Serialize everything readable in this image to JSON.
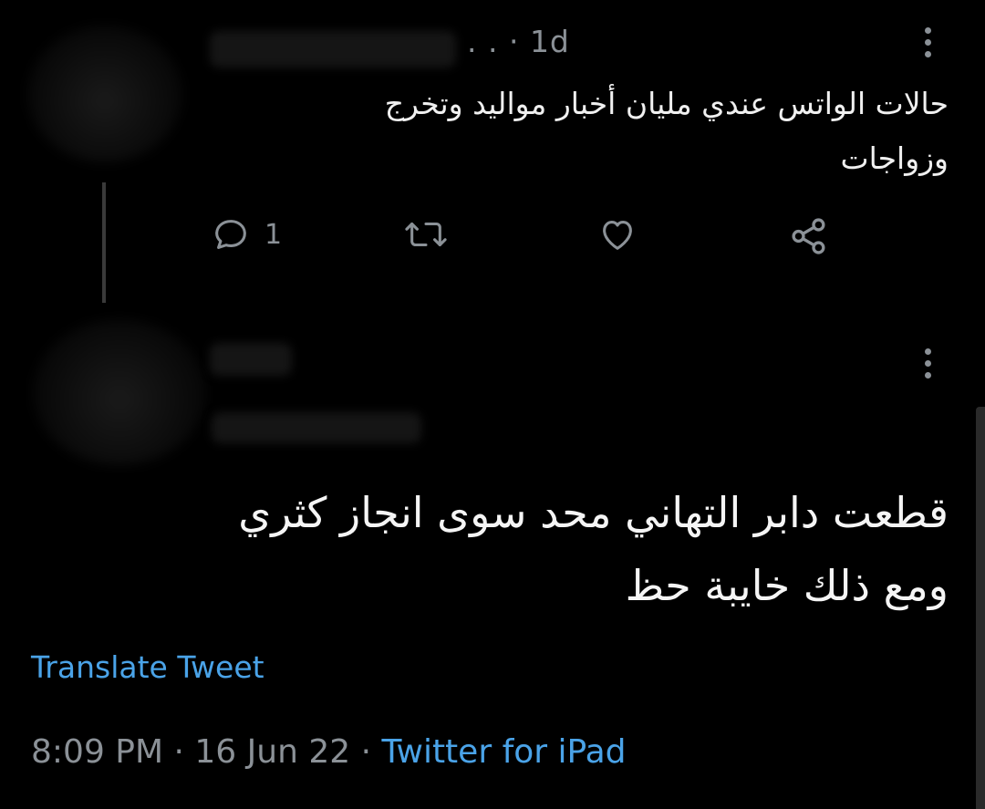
{
  "tweet1": {
    "time": ". . · 1d",
    "text_line1": "حالات الواتس عندي مليان أخبار مواليد وتخرج",
    "text_line2": "وزواجات",
    "reply_count": "1"
  },
  "tweet2": {
    "text_line1": "قطعت دابر التهاني محد سوى انجاز كثري",
    "text_line2": "ومع ذلك خايبة حظ",
    "translate_label": "Translate Tweet",
    "timestamp": "8:09 PM · 16 Jun 22 · ",
    "source": "Twitter for iPad"
  },
  "icons": {
    "reply": "reply-icon",
    "retweet": "retweet-icon",
    "like": "like-icon",
    "share": "share-icon",
    "more": "more-options-icon"
  },
  "colors": {
    "background": "#000000",
    "text": "#f0f0f0",
    "muted": "#8b9197",
    "link": "#4aa3e8"
  }
}
